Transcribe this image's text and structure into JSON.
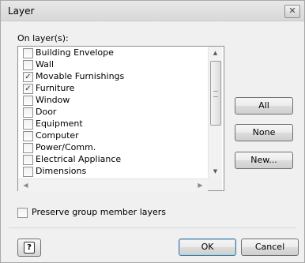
{
  "window": {
    "title": "Layer",
    "close_symbol": "✕"
  },
  "on_layer_label": "On layer(s):",
  "layers": [
    {
      "label": "Building Envelope",
      "checked": false
    },
    {
      "label": "Wall",
      "checked": false
    },
    {
      "label": "Movable Furnishings",
      "checked": true
    },
    {
      "label": "Furniture",
      "checked": true
    },
    {
      "label": "Window",
      "checked": false
    },
    {
      "label": "Door",
      "checked": false
    },
    {
      "label": "Equipment",
      "checked": false
    },
    {
      "label": "Computer",
      "checked": false
    },
    {
      "label": "Power/Comm.",
      "checked": false
    },
    {
      "label": "Electrical Appliance",
      "checked": false
    },
    {
      "label": "Dimensions",
      "checked": false
    }
  ],
  "side_buttons": {
    "all": "All",
    "none": "None",
    "new": "New..."
  },
  "preserve": {
    "label": "Preserve group member layers",
    "checked": false
  },
  "footer": {
    "ok": "OK",
    "cancel": "Cancel",
    "help_symbol": "?"
  },
  "icons": {
    "close": "close-icon",
    "scroll_up": "arrow-up-icon",
    "scroll_down": "arrow-down-icon",
    "scroll_left": "arrow-left-icon",
    "scroll_right": "arrow-right-icon",
    "help": "help-icon",
    "check": "checkmark-icon"
  }
}
